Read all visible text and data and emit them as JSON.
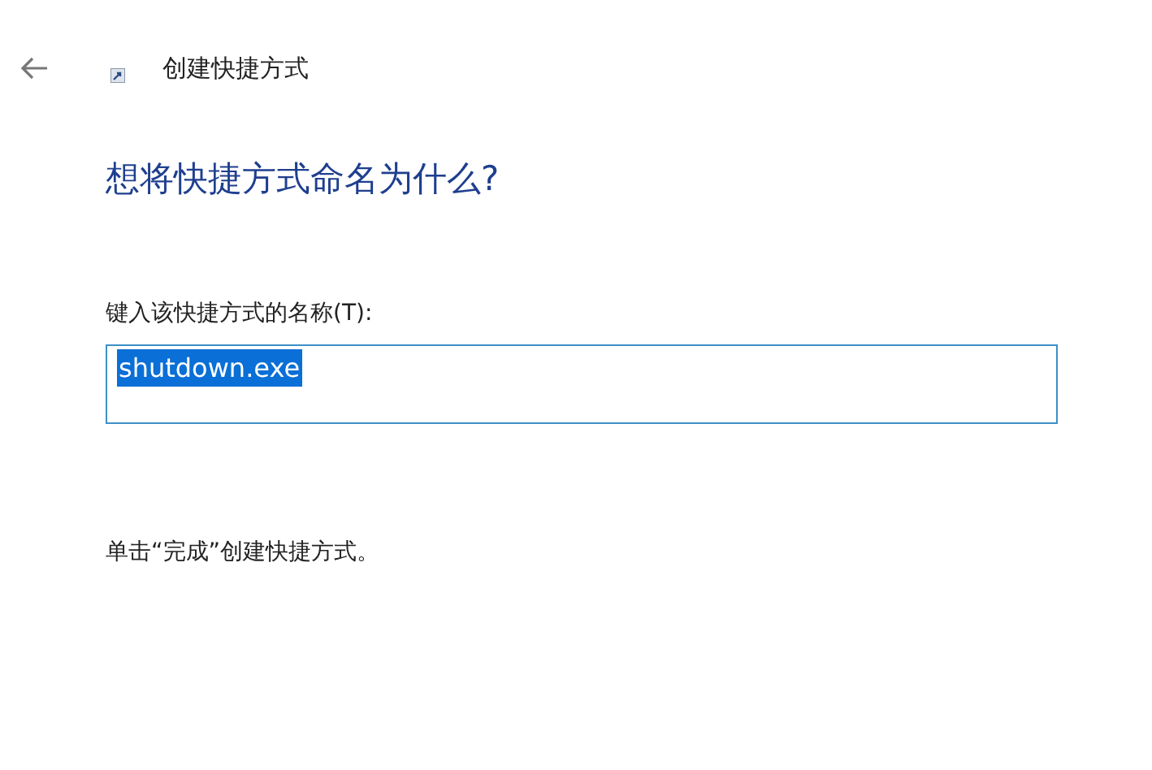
{
  "window": {
    "title": "创建快捷方式"
  },
  "heading": "想将快捷方式命名为什么?",
  "name_field": {
    "label": "键入该快捷方式的名称(T):",
    "value": "shutdown.exe",
    "selected": true
  },
  "instruction": "单击“完成”创建快捷方式。"
}
